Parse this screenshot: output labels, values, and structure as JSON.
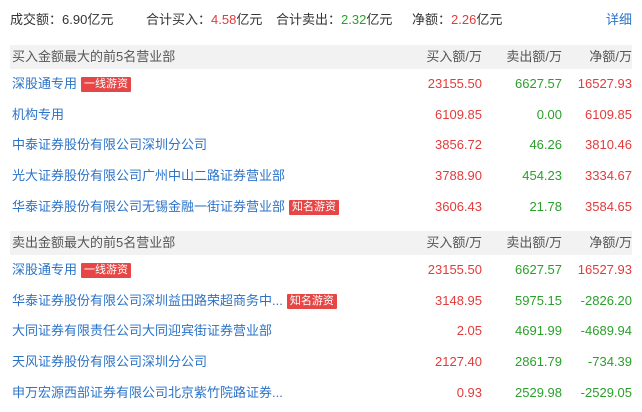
{
  "summary": {
    "turnover_label": "成交额：",
    "turnover_value": "6.90",
    "turnover_unit": "亿元",
    "buy_label": "合计买入：",
    "buy_value": "4.58",
    "buy_unit": "亿元",
    "sell_label": "合计卖出：",
    "sell_value": "2.32",
    "sell_unit": "亿元",
    "net_label": "净额：",
    "net_value": "2.26",
    "net_unit": "亿元",
    "detail_link": "详细"
  },
  "columns": {
    "buy": "买入额/万",
    "sell": "卖出额/万",
    "net": "净额/万"
  },
  "buy_section": {
    "title": "买入金额最大的前5名营业部",
    "rows": [
      {
        "name": "深股通专用",
        "tag": "一线游资",
        "buy": "23155.50",
        "sell": "6627.57",
        "net": "16527.93",
        "net_sign": "pos"
      },
      {
        "name": "机构专用",
        "tag": "",
        "buy": "6109.85",
        "sell": "0.00",
        "net": "6109.85",
        "net_sign": "pos"
      },
      {
        "name": "中泰证券股份有限公司深圳分公司",
        "tag": "",
        "buy": "3856.72",
        "sell": "46.26",
        "net": "3810.46",
        "net_sign": "pos"
      },
      {
        "name": "光大证券股份有限公司广州中山二路证券营业部",
        "tag": "",
        "buy": "3788.90",
        "sell": "454.23",
        "net": "3334.67",
        "net_sign": "pos"
      },
      {
        "name": "华泰证券股份有限公司无锡金融一街证券营业部",
        "tag": "知名游资",
        "buy": "3606.43",
        "sell": "21.78",
        "net": "3584.65",
        "net_sign": "pos"
      }
    ]
  },
  "sell_section": {
    "title": "卖出金额最大的前5名营业部",
    "rows": [
      {
        "name": "深股通专用",
        "tag": "一线游资",
        "buy": "23155.50",
        "sell": "6627.57",
        "net": "16527.93",
        "net_sign": "pos"
      },
      {
        "name": "华泰证券股份有限公司深圳益田路荣超商务中...",
        "tag": "知名游资",
        "buy": "3148.95",
        "sell": "5975.15",
        "net": "-2826.20",
        "net_sign": "neg"
      },
      {
        "name": "大同证券有限责任公司大同迎宾街证券营业部",
        "tag": "",
        "buy": "2.05",
        "sell": "4691.99",
        "net": "-4689.94",
        "net_sign": "neg"
      },
      {
        "name": "天风证券股份有限公司深圳分公司",
        "tag": "",
        "buy": "2127.40",
        "sell": "2861.79",
        "net": "-734.39",
        "net_sign": "neg"
      },
      {
        "name": "申万宏源西部证券有限公司北京紫竹院路证券...",
        "tag": "",
        "buy": "0.93",
        "sell": "2529.98",
        "net": "-2529.05",
        "net_sign": "neg"
      }
    ]
  }
}
